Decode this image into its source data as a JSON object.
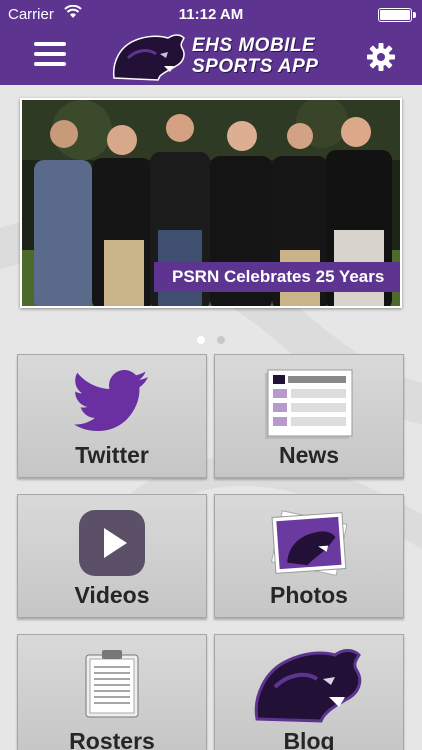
{
  "status_bar": {
    "carrier": "Carrier",
    "time": "11:12 AM"
  },
  "header": {
    "logo_line1": "EHS MOBILE",
    "logo_line2": "SPORTS APP",
    "menu_icon": "hamburger-menu-icon",
    "settings_icon": "gear-icon"
  },
  "banner": {
    "caption": "PSRN Celebrates 25 Years",
    "slides": 2,
    "active_slide": 1
  },
  "tiles": [
    {
      "label": "Twitter",
      "icon": "twitter-bird-icon"
    },
    {
      "label": "News",
      "icon": "newspaper-icon"
    },
    {
      "label": "Videos",
      "icon": "play-button-icon"
    },
    {
      "label": "Photos",
      "icon": "photo-stack-icon"
    },
    {
      "label": "Rosters",
      "icon": "clipboard-icon"
    },
    {
      "label": "Blog",
      "icon": "panther-logo-icon"
    }
  ],
  "colors": {
    "brand_purple": "#5d3591",
    "tile_background": "#d0d0d0",
    "page_background": "#e6e6e6"
  }
}
